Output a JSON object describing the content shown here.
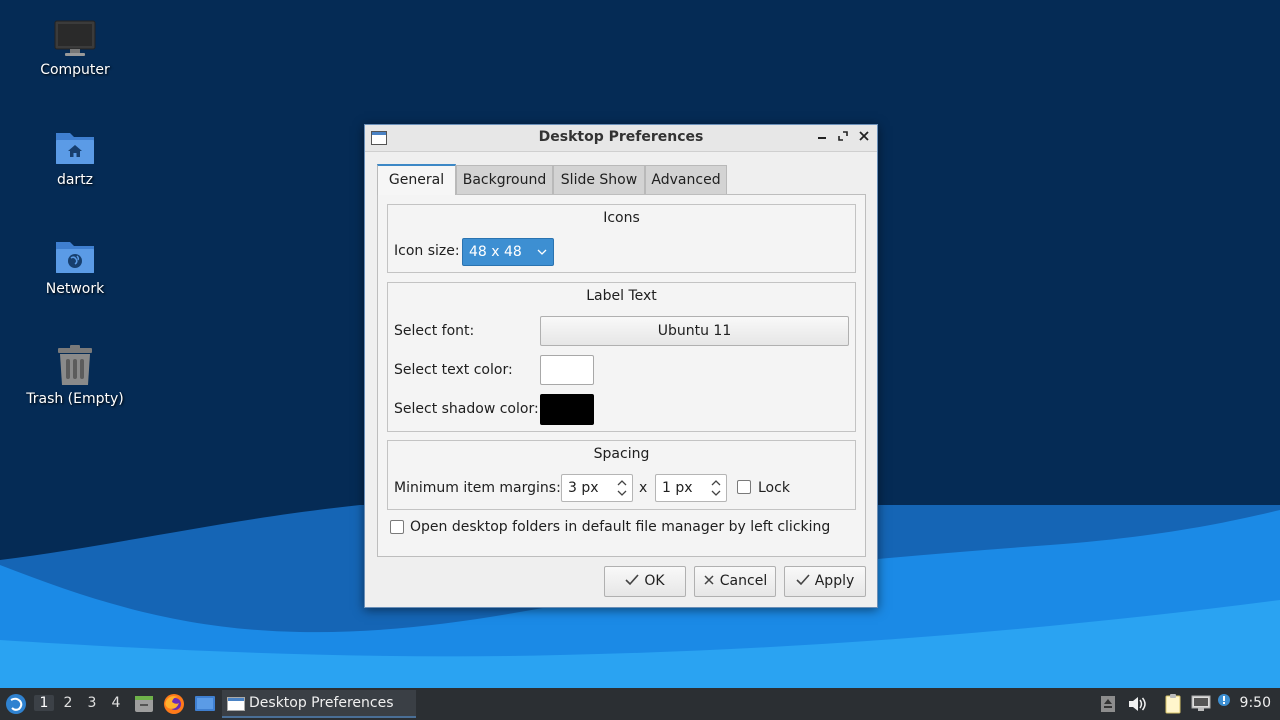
{
  "desktop_icons": [
    {
      "label": "Computer",
      "icon": "computer-icon"
    },
    {
      "label": "dartz",
      "icon": "home-folder-icon"
    },
    {
      "label": "Network",
      "icon": "network-folder-icon"
    },
    {
      "label": "Trash (Empty)",
      "icon": "trash-icon"
    }
  ],
  "dialog": {
    "title": "Desktop Preferences",
    "tabs": [
      "General",
      "Background",
      "Slide Show",
      "Advanced"
    ],
    "active_tab": "General",
    "icons_group": {
      "title": "Icons",
      "icon_size_label": "Icon size:",
      "icon_size_value": "48 x 48"
    },
    "label_group": {
      "title": "Label Text",
      "font_label": "Select font:",
      "font_value": "Ubuntu 11",
      "text_color_label": "Select text color:",
      "text_color": "#ffffff",
      "shadow_color_label": "Select shadow color:",
      "shadow_color": "#000000"
    },
    "spacing_group": {
      "title": "Spacing",
      "margins_label": "Minimum item margins:",
      "margin_x": "3 px",
      "separator": "x",
      "margin_y": "1 px",
      "lock_label": "Lock",
      "lock_checked": false
    },
    "open_folders_label": "Open desktop folders in default file manager by left clicking",
    "open_folders_checked": false,
    "buttons": {
      "ok": "OK",
      "cancel": "Cancel",
      "apply": "Apply"
    }
  },
  "taskbar": {
    "workspaces": [
      "1",
      "2",
      "3",
      "4"
    ],
    "active_workspace": "1",
    "task_label": "Desktop Preferences",
    "clock": "9:50"
  },
  "colors": {
    "desktop_bg": "#052b55",
    "accent": "#3d8fd2",
    "taskbar_bg": "#2b2f33"
  }
}
